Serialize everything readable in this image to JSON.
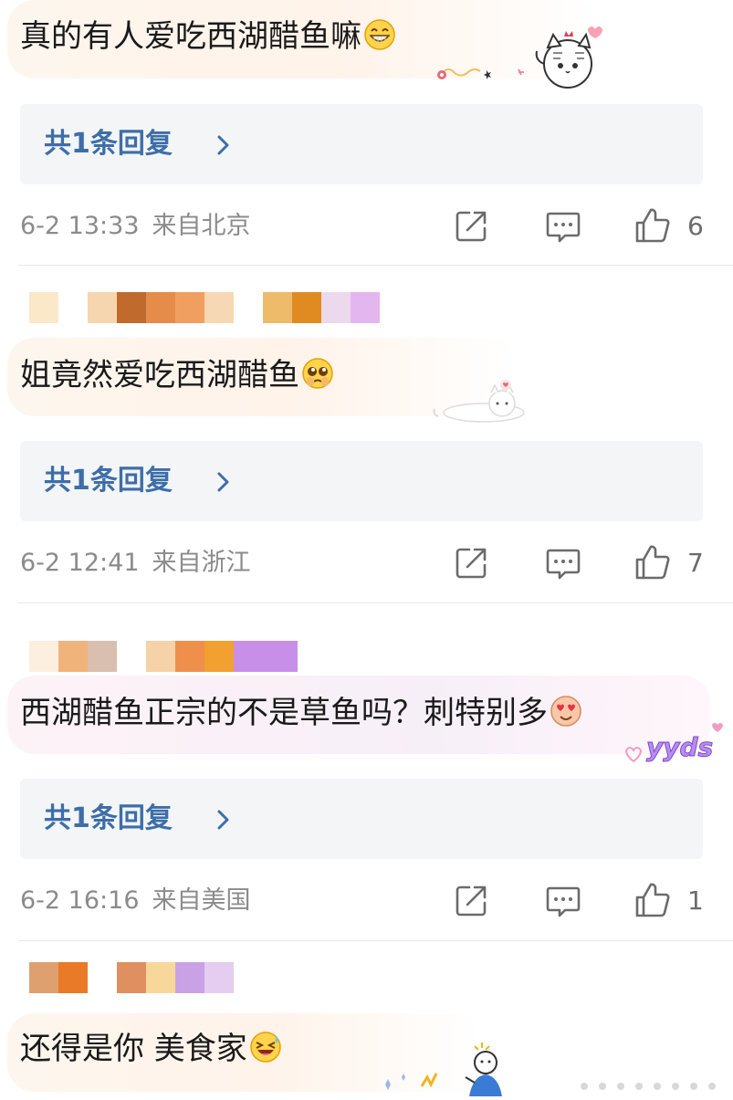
{
  "comments": [
    {
      "text": "真的有人爱吃西湖醋鱼嘛",
      "emoji": "grin-emoji",
      "sticker": "cat-waving-sticker",
      "reply_label": "共1条回复",
      "time": "6-2 13:33",
      "location": "来自北京",
      "likes": "6"
    },
    {
      "text": "姐竟然爱吃西湖醋鱼",
      "emoji": "pleading-emoji",
      "sticker": "cat-lying-sticker",
      "reply_label": "共1条回复",
      "time": "6-2 12:41",
      "location": "来自浙江",
      "likes": "7"
    },
    {
      "text": "西湖醋鱼正宗的不是草鱼吗？刺特别多",
      "emoji": "heart-eyes-emoji",
      "sticker": "yyds-sticker",
      "sticker_text": "yyds",
      "reply_label": "共1条回复",
      "time": "6-2 16:16",
      "location": "来自美国",
      "likes": "1"
    },
    {
      "text": "还得是你 美食家",
      "emoji": "laughing-emoji",
      "sticker": "person-sparkle-sticker"
    }
  ],
  "icons": {
    "share": "share-icon",
    "comment": "comment-icon",
    "like": "thumbs-up-icon",
    "chevron": "chevron-right-icon"
  },
  "colors": {
    "reply_link": "#3d6ea8",
    "meta_text": "#8b8b8b",
    "reply_bg": "#f4f5f7",
    "divider": "#e8e8e8"
  }
}
